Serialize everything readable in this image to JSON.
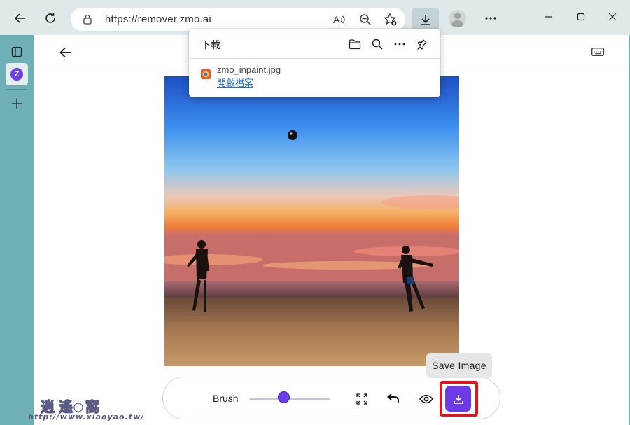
{
  "browser": {
    "url": "https://remover.zmo.ai",
    "back_icon": "arrow-left-icon",
    "refresh_icon": "refresh-icon",
    "lock_icon": "lock-icon",
    "read_aloud_icon": "read-aloud-icon",
    "zoom_icon": "zoom-out-icon",
    "favorite_icon": "favorite-add-icon",
    "downloads_icon": "download-icon",
    "more_icon": "more-icon",
    "window_controls": [
      "minimize",
      "maximize",
      "close"
    ],
    "accent_color": "#6fb0b7"
  },
  "sidebar": {
    "items": [
      {
        "name": "tab-panel-icon"
      },
      {
        "name": "zmo-tab",
        "label": "Z"
      },
      {
        "name": "add-tab-icon"
      }
    ]
  },
  "downloads_panel": {
    "title": "下載",
    "file_name": "zmo_inpaint.jpg",
    "open_file_label": "開啟檔案",
    "icons": [
      "folder-icon",
      "search-icon",
      "more-icon",
      "pin-icon"
    ]
  },
  "page": {
    "back_icon": "arrow-left-icon",
    "keyboard_icon": "keyboard-icon"
  },
  "toolbar": {
    "brush_label": "Brush",
    "brush_size_fraction": 0.43,
    "tools": [
      "fullscreen-icon",
      "undo-icon",
      "eye-icon",
      "save-download-icon"
    ],
    "accent_color": "#6e3ae8"
  },
  "tooltip": {
    "text": "Save Image"
  },
  "watermark": {
    "text": "http://www.xiaoyao.tw/"
  }
}
